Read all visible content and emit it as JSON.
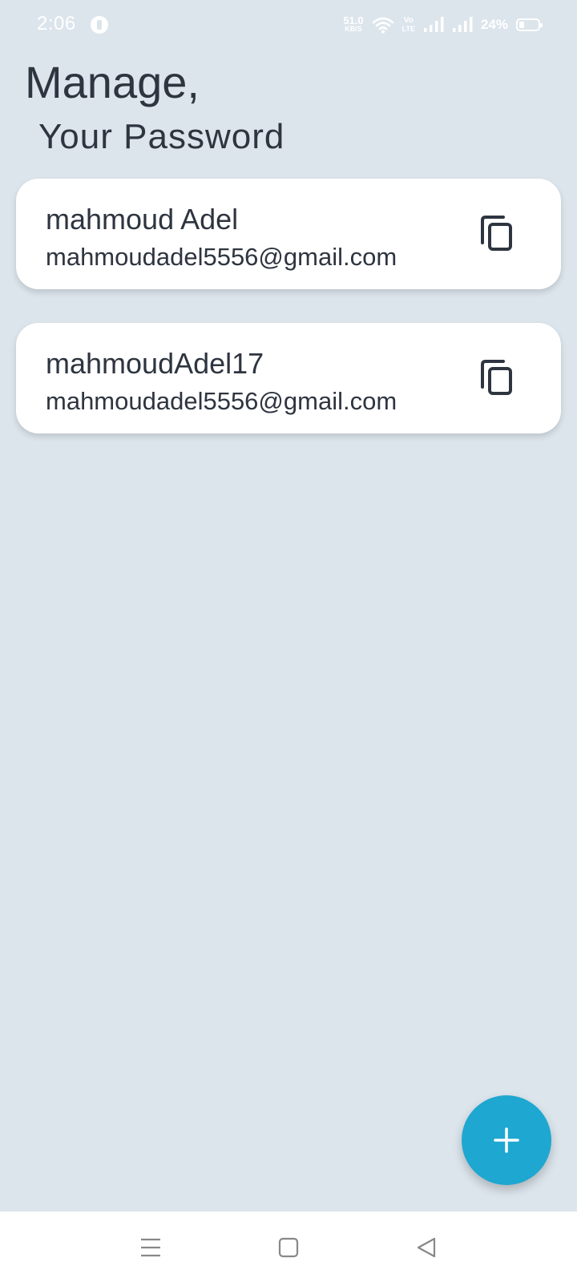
{
  "status_bar": {
    "time": "2:06",
    "net_speed_value": "51.0",
    "net_speed_unit": "KB/S",
    "volte_top": "Vo",
    "volte_bottom": "LTE",
    "battery_percent": "24%",
    "battery_level": 0.24,
    "icons": [
      "app-notification-icon",
      "wifi-icon",
      "volte-icon",
      "signal-icon",
      "signal-icon",
      "battery-icon"
    ]
  },
  "header": {
    "title": "Manage,",
    "subtitle": "Your Password"
  },
  "passwords": [
    {
      "name": "mahmoud Adel",
      "email": "mahmoudadel5556@gmail.com",
      "action_icon": "copy-icon"
    },
    {
      "name": "mahmoudAdel17",
      "email": "mahmoudadel5556@gmail.com",
      "action_icon": "copy-icon"
    }
  ],
  "fab": {
    "icon": "plus-icon",
    "color": "#1ea7d0"
  },
  "nav_bar": {
    "icons": [
      "menu-icon",
      "home-square-icon",
      "back-triangle-icon"
    ]
  },
  "colors": {
    "background": "#dce5ec",
    "card": "#ffffff",
    "text": "#2e3540",
    "accent": "#1ea7d0"
  }
}
